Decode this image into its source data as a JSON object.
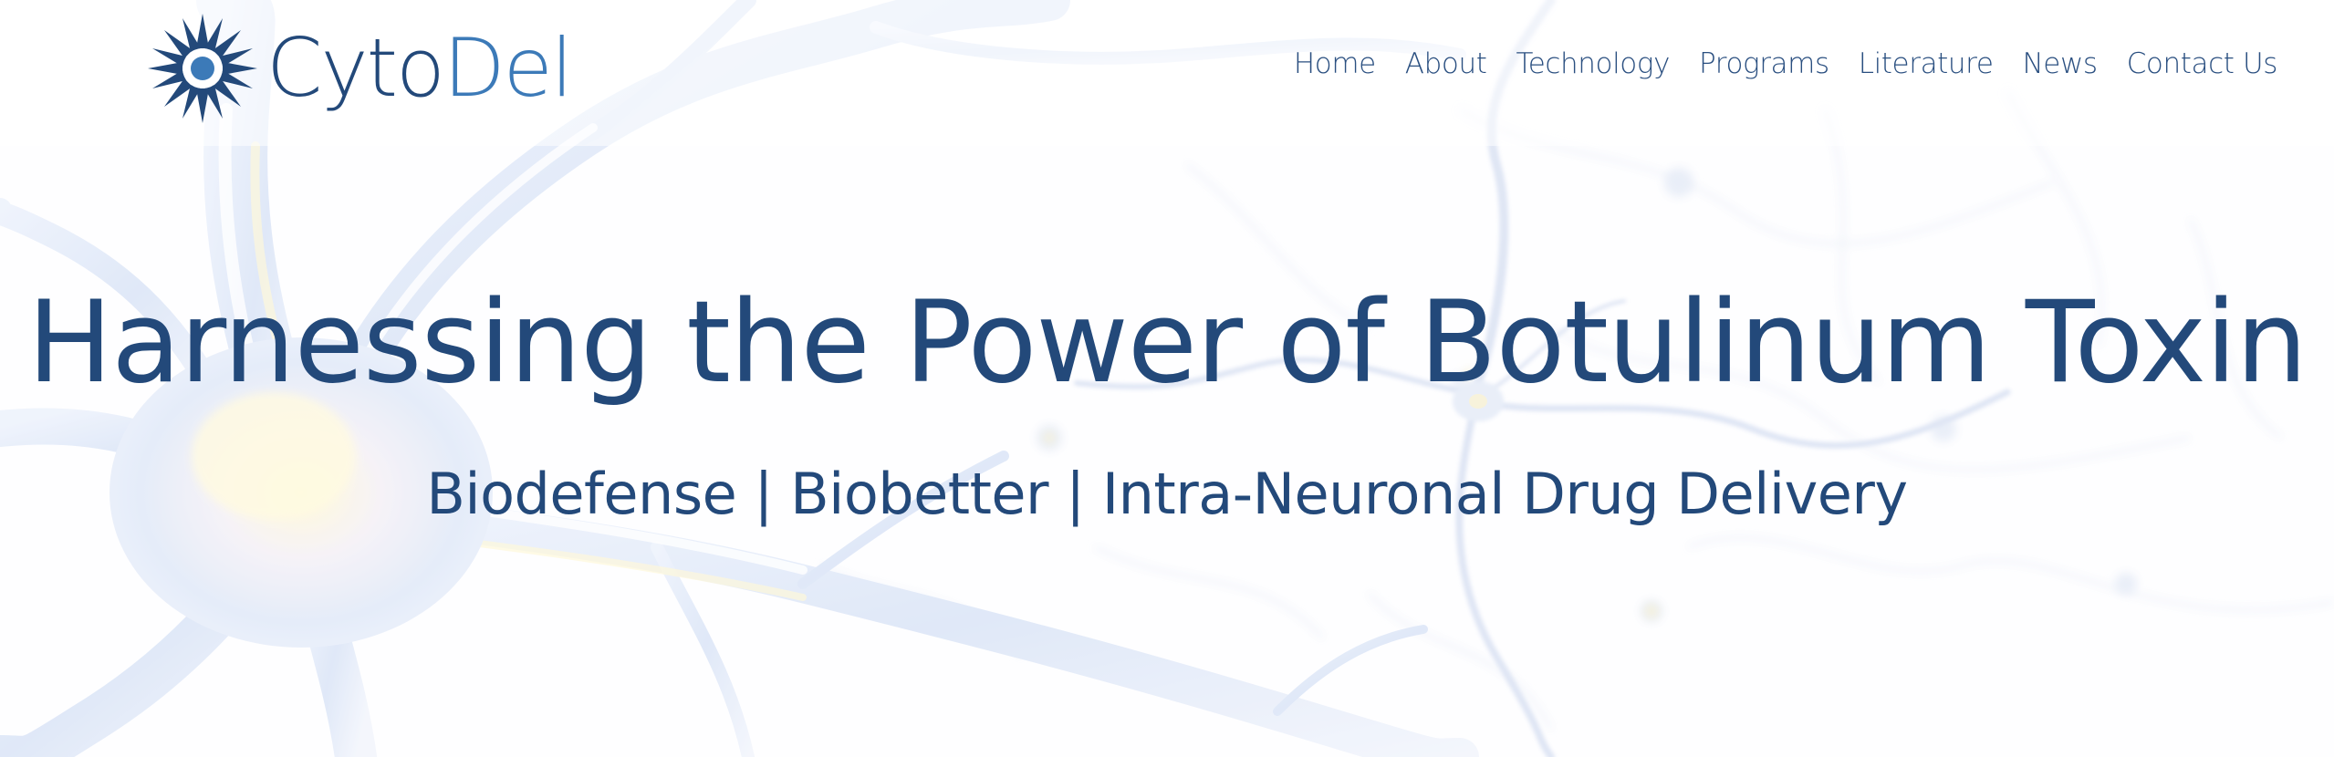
{
  "logo": {
    "brand_part1": "Cyto",
    "brand_part2": "Del",
    "colors": {
      "dark_blue": "#23497a",
      "light_blue": "#3c7ab8"
    },
    "icon": "starburst-logo-icon"
  },
  "nav": {
    "items": [
      {
        "label": "Home"
      },
      {
        "label": "About"
      },
      {
        "label": "Technology"
      },
      {
        "label": "Programs"
      },
      {
        "label": "Literature"
      },
      {
        "label": "News"
      },
      {
        "label": "Contact Us"
      }
    ],
    "color": "#2a4f80"
  },
  "hero": {
    "title": "Harnessing the Power of Botulinum Toxin",
    "subtitle": "Biodefense | Biobetter | Intra-Neuronal Drug Delivery",
    "background_image": "neuron-illustration"
  }
}
